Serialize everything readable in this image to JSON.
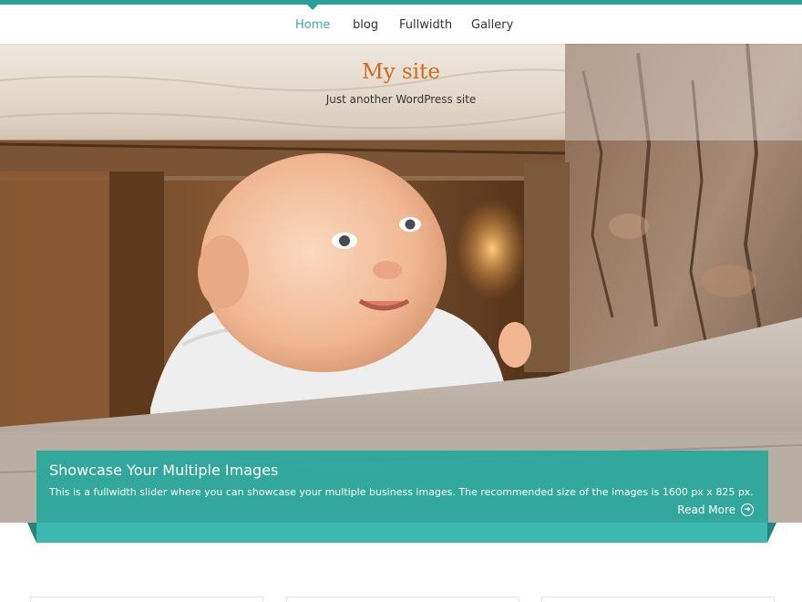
{
  "nav": {
    "items": [
      {
        "label": "Home",
        "active": true
      },
      {
        "label": "blog",
        "active": false
      },
      {
        "label": "Fullwidth",
        "active": false
      },
      {
        "label": "Gallery",
        "active": false
      }
    ]
  },
  "header": {
    "site_title": "My site",
    "site_description": "Just another WordPress site"
  },
  "slider": {
    "caption_title": "Showcase Your Multiple Images",
    "caption_text": "This is a fullwidth slider where you can showcase your multiple business images. The recommended size of the images is 1600 px x 825 px.",
    "read_more_label": "Read More",
    "read_more_icon": "arrow-circle-right-icon"
  },
  "colors": {
    "accent": "#2aa198",
    "title": "#d2691e",
    "caption_bg": "#26a69a"
  }
}
